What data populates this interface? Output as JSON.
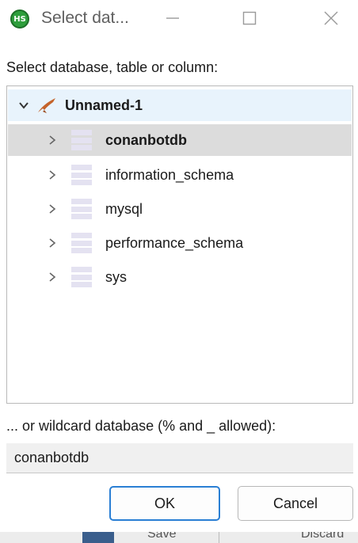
{
  "window": {
    "title": "Select dat...",
    "app_icon_text": "HS",
    "app_icon_name": "heidisql-icon"
  },
  "prompt": "Select database, table or column:",
  "tree": {
    "root": {
      "label": "Unnamed-1",
      "icon": "dolphin-icon",
      "expanded": true
    },
    "items": [
      {
        "label": "conanbotdb",
        "selected": true
      },
      {
        "label": "information_schema",
        "selected": false
      },
      {
        "label": "mysql",
        "selected": false
      },
      {
        "label": "performance_schema",
        "selected": false
      },
      {
        "label": "sys",
        "selected": false
      }
    ]
  },
  "wildcard": {
    "label": "... or wildcard database (% and _ allowed):",
    "value": "conanbotdb"
  },
  "buttons": {
    "ok": "OK",
    "cancel": "Cancel"
  },
  "underlying_window": {
    "save": "Save",
    "discard": "Discard"
  },
  "colors": {
    "root_highlight": "#e8f3fc",
    "selected_row": "#dcdcdc",
    "ok_border": "#2a7fd4"
  }
}
